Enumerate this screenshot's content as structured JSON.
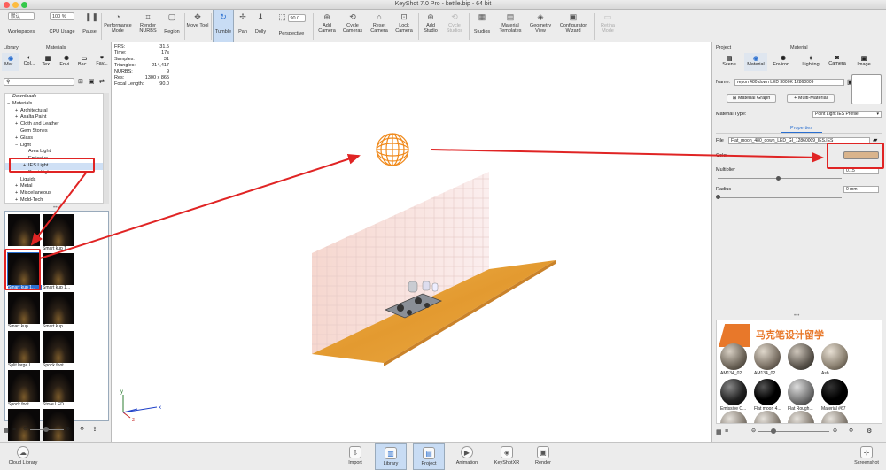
{
  "window": {
    "title": "KeyShot 7.0 Pro  -  kettle.bip  -  64 bit"
  },
  "toolbar": {
    "workspace_select": "默认",
    "cpu_select": "100 %",
    "fov_value": "90.0",
    "items": [
      {
        "label": "Workspaces"
      },
      {
        "label": "CPU Usage"
      },
      {
        "label": "Pause"
      },
      {
        "label": "Performance Mode"
      },
      {
        "label": "Render NURBS"
      },
      {
        "label": "Region"
      },
      {
        "label": "Move Tool"
      },
      {
        "label": "Tumble"
      },
      {
        "label": "Pan"
      },
      {
        "label": "Dolly"
      },
      {
        "label": "Perspective"
      },
      {
        "label": "Add Camera"
      },
      {
        "label": "Cycle Cameras"
      },
      {
        "label": "Reset Camera"
      },
      {
        "label": "Lock Camera"
      },
      {
        "label": "Add Studio"
      },
      {
        "label": "Cycle Studios"
      },
      {
        "label": "Studios"
      },
      {
        "label": "Material Templates"
      },
      {
        "label": "Geometry View"
      },
      {
        "label": "Configurator Wizard"
      },
      {
        "label": "Retina Mode"
      }
    ]
  },
  "library": {
    "title": "Library",
    "subtitle": "Materials",
    "tabs": [
      "Mat...",
      "Col...",
      "Tex...",
      "Envi...",
      "Bac...",
      "Fav..."
    ],
    "tree": [
      {
        "label": "Downloads",
        "indent": 0,
        "expander": ""
      },
      {
        "label": "Materials",
        "indent": 0,
        "expander": "−"
      },
      {
        "label": "Architectural",
        "indent": 1,
        "expander": "+"
      },
      {
        "label": "Axalta Paint",
        "indent": 1,
        "expander": "+"
      },
      {
        "label": "Cloth and Leather",
        "indent": 1,
        "expander": "+"
      },
      {
        "label": "Gem Stones",
        "indent": 1,
        "expander": ""
      },
      {
        "label": "Glass",
        "indent": 1,
        "expander": "+"
      },
      {
        "label": "Light",
        "indent": 1,
        "expander": "−"
      },
      {
        "label": "Area Light",
        "indent": 2,
        "expander": ""
      },
      {
        "label": "Emissive",
        "indent": 2,
        "expander": ""
      },
      {
        "label": "IES Light",
        "indent": 2,
        "expander": "+",
        "selected": true
      },
      {
        "label": "Point Light",
        "indent": 2,
        "expander": ""
      },
      {
        "label": "Liquids",
        "indent": 1,
        "expander": ""
      },
      {
        "label": "Metal",
        "indent": 1,
        "expander": "+"
      },
      {
        "label": "Miscellaneous",
        "indent": 1,
        "expander": "+"
      },
      {
        "label": "Mold-Tech",
        "indent": 1,
        "expander": "+"
      }
    ],
    "thumbnails": [
      "",
      "Smart kup 1...",
      "Smart kup 1...",
      "Smart kup 1...",
      "Smart kup ...",
      "Smart kup ...",
      "Split large L...",
      "Spock foot ...",
      "Spock foot ...",
      "Stove LED ...",
      "",
      ""
    ]
  },
  "hud": {
    "rows": [
      {
        "k": "FPS:",
        "v": "31.5"
      },
      {
        "k": "Time:",
        "v": "17s"
      },
      {
        "k": "Samples:",
        "v": "31"
      },
      {
        "k": "Triangles:",
        "v": "214,417"
      },
      {
        "k": "NURBS:",
        "v": "9"
      },
      {
        "k": "Res:",
        "v": "1300 x 865"
      },
      {
        "k": "Focal Length:",
        "v": "90.0"
      }
    ]
  },
  "project": {
    "title": "Project",
    "subtitle": "Material",
    "tabs": [
      "Scene",
      "Material",
      "Environ...",
      "Lighting",
      "Camera",
      "Image"
    ],
    "name_label": "Name:",
    "name_value": "repon 480 down LED 3000K 12860009",
    "material_graph": "Material Graph",
    "multi_material": "Multi-Material",
    "type_label": "Material Type:",
    "type_value": "Point Light IES Profile",
    "properties_tab": "Properties",
    "file_label": "File",
    "file_value": "Flat_moon_480_down_LED_GI_12860009_IES.IES",
    "color_label": "Color",
    "color_value": "#d9b48c",
    "multiplier_label": "Multiplier",
    "multiplier_value": "0.15",
    "radius_label": "Radius",
    "radius_value": "0 mm",
    "watermark": "马克笔设计留学",
    "material_labels": [
      "AM134_02...",
      "AM134_02...",
      "",
      "Ash",
      "Emissive C...",
      "Flat moon 4...",
      "Flat Rough...",
      "Material #67"
    ]
  },
  "bottombar": {
    "cloud": "Cloud Library",
    "screenshot": "Screenshot",
    "buttons": [
      "Import",
      "Library",
      "Project",
      "Animation",
      "KeyShotXR",
      "Render"
    ]
  },
  "accents": {
    "annotation_red": "#e02424",
    "selection_blue": "#cfe0f5",
    "wood": "#e9a23a"
  }
}
